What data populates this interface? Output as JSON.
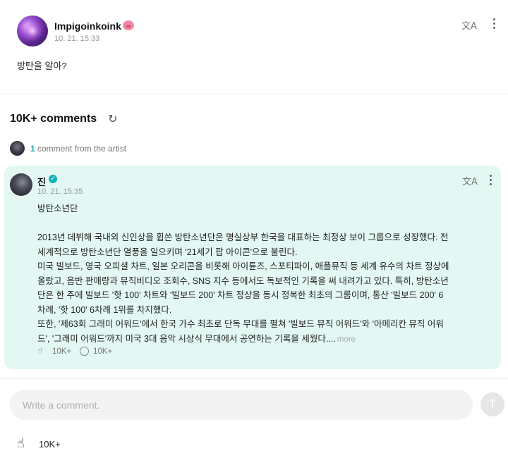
{
  "post": {
    "author": "Impigoinkoink",
    "author_emoji_icon": "pig-face-icon",
    "date": "10. 21. 15:33",
    "body": "방탄을 알아?",
    "translate_icon": "文A",
    "more_icon": "more-vertical-icon"
  },
  "comments_section": {
    "title": "10K+ comments",
    "refresh_icon": "↻",
    "artist_count": "1",
    "artist_text": "comment from the artist"
  },
  "comment": {
    "author": "진",
    "verified_icon": "✓",
    "date": "10. 21. 15:35",
    "paragraphs": [
      "방탄소년단",
      "",
      "2013년 데뷔해 국내외 신인상을 휩쓴 방탄소년단은 명실상부 한국을 대표하는 최정상 보이 그룹으로 성장했다. 전",
      "세계적으로 방탄소년단 열풍을 일으키며 '21세기 팝 아이콘'으로 불린다.",
      "미국 빌보드, 영국 오피셜 차트, 일본 오리콘을 비롯해 아이튠즈, 스포티파이, 애플뮤직 등 세계 유수의 차트 정상에",
      "올랐고, 음반 판매량과 뮤직비디오 조회수, SNS 지수 등에서도 독보적인 기록을 써 내려가고 있다. 특히, 방탄소년",
      "단은 한 주에 빌보드 '핫 100' 차트와 '빌보드 200' 차트 정상을 동시 정복한 최초의 그룹이며, 통산 '빌보드 200' 6",
      "차례, '핫 100' 6차례 1위를 차지했다.",
      "또한, '제63회 그래미 어워드'에서 한국 가수 최초로 단독 무대를 펼쳐 '빌보드 뮤직 어워드'와 '아메리칸 뮤직 어워",
      "드', '그래미 어워드'까지 미국 3대 음악 시상식 무대에서 공연하는 기록을 세웠다...."
    ],
    "more_label": "more",
    "like_count": "10K+",
    "reply_count": "10K+"
  },
  "input": {
    "placeholder": "Write a comment.",
    "send_icon": "↑"
  },
  "footer": {
    "like_icon": "like-hand-icon",
    "like_count": "10K+"
  }
}
